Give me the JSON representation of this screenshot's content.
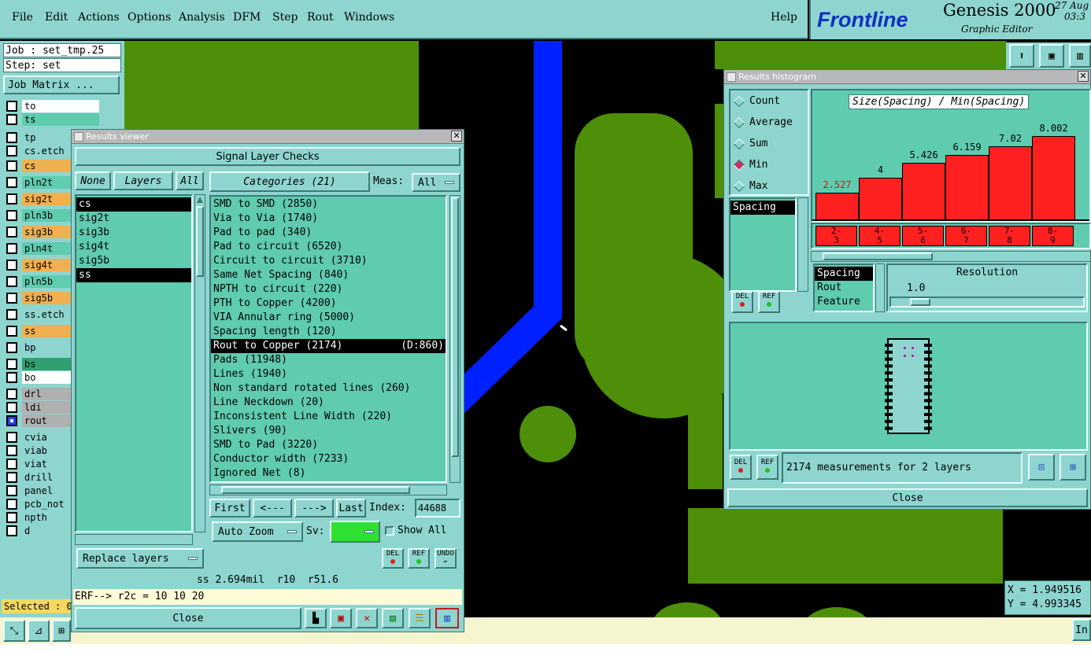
{
  "menu": {
    "items": [
      "File",
      "Edit",
      "Actions",
      "Options",
      "Analysis",
      "DFM",
      "Step",
      "Rout",
      "Windows"
    ],
    "help": "Help"
  },
  "brand": {
    "logo": "Frontline",
    "product": "Genesis 2000",
    "subtitle": "Graphic Editor",
    "date_line1": "27 Aug",
    "date_line2": "03:3"
  },
  "job": {
    "job_label": "Job : set_tmp.25",
    "step_label": "Step: set",
    "matrix_button": "Job Matrix ..."
  },
  "layers": [
    {
      "name": "to",
      "color": "#ffffff"
    },
    {
      "name": "ts",
      "color": "#5fcbaf"
    },
    {
      "name": "tp",
      "color": "#8ed5cf"
    },
    {
      "name": "cs.etch",
      "color": "#8ed5cf"
    },
    {
      "name": "cs",
      "color": "#f0b050"
    },
    {
      "name": "pln2t",
      "color": "#5fcbaf"
    },
    {
      "name": "sig2t",
      "color": "#f0b050"
    },
    {
      "name": "pln3b",
      "color": "#5fcbaf"
    },
    {
      "name": "sig3b",
      "color": "#f0b050"
    },
    {
      "name": "pln4t",
      "color": "#5fcbaf"
    },
    {
      "name": "sig4t",
      "color": "#f0b050"
    },
    {
      "name": "pln5b",
      "color": "#5fcbaf"
    },
    {
      "name": "sig5b",
      "color": "#f0b050"
    },
    {
      "name": "ss.etch",
      "color": "#8ed5cf"
    },
    {
      "name": "ss",
      "color": "#f0b050"
    },
    {
      "name": "bp",
      "color": "#8ed5cf"
    },
    {
      "name": "bs",
      "color": "#30a070"
    },
    {
      "name": "bo",
      "color": "#ffffff"
    },
    {
      "name": "drl",
      "color": "#b0b0b0"
    },
    {
      "name": "ldi",
      "color": "#b0b0b0"
    },
    {
      "name": "rout",
      "color": "#b0b0b0",
      "active": true
    },
    {
      "name": "cvia",
      "color": "#8ed5cf"
    },
    {
      "name": "viab",
      "color": "#8ed5cf"
    },
    {
      "name": "viat",
      "color": "#8ed5cf"
    },
    {
      "name": "drill",
      "color": "#8ed5cf"
    },
    {
      "name": "panel",
      "color": "#8ed5cf"
    },
    {
      "name": "pcb_not",
      "color": "#8ed5cf"
    },
    {
      "name": "npth",
      "color": "#8ed5cf"
    },
    {
      "name": "d",
      "color": "#8ed5cf"
    }
  ],
  "selected_label": "Selected : 0",
  "results_viewer": {
    "title": "Results viewer",
    "header": "Signal Layer Checks",
    "none_btn": "None",
    "layers_btn": "Layers",
    "all_btn": "All",
    "layer_list": [
      {
        "name": "cs",
        "selected": true
      },
      {
        "name": "sig2t",
        "selected": false
      },
      {
        "name": "sig3b",
        "selected": false
      },
      {
        "name": "sig4t",
        "selected": false
      },
      {
        "name": "sig5b",
        "selected": false
      },
      {
        "name": "ss",
        "selected": true
      }
    ],
    "categories_btn": "Categories (21)",
    "meas_label": "Meas:",
    "meas_value": "All",
    "categories": [
      {
        "text": "SMD to SMD (2850)"
      },
      {
        "text": "Via to Via (1740)"
      },
      {
        "text": "Pad to pad (340)"
      },
      {
        "text": "Pad to circuit (6520)"
      },
      {
        "text": "Circuit to circuit (3710)"
      },
      {
        "text": "Same Net Spacing (840)"
      },
      {
        "text": "NPTH to circuit (220)"
      },
      {
        "text": "PTH to Copper (4200)"
      },
      {
        "text": "VIA Annular ring (5000)"
      },
      {
        "text": "Spacing length (120)"
      },
      {
        "text": "Rout to Copper (2174)",
        "extra": "(D:860)",
        "selected": true
      },
      {
        "text": "Pads (11948)"
      },
      {
        "text": "Lines (1940)"
      },
      {
        "text": "Non standard rotated lines (260)"
      },
      {
        "text": "Line Neckdown (20)"
      },
      {
        "text": "Inconsistent Line Width (220)"
      },
      {
        "text": "Slivers (90)"
      },
      {
        "text": "SMD to Pad (3220)"
      },
      {
        "text": "Conductor width (7233)"
      },
      {
        "text": "Ignored Net (8)"
      }
    ],
    "nav": {
      "first": "First",
      "prev": "<---",
      "next": "--->",
      "last": "Last",
      "index_label": "Index:",
      "index_value": "44688"
    },
    "auto_zoom": "Auto Zoom",
    "sv_label": "Sv:",
    "show_all": "Show All",
    "replace_layers": "Replace layers",
    "del": "DEL",
    "ref": "REF",
    "undo": "UNDO",
    "status": "ss 2.694mil  r10  r51.6",
    "erf": "ERF--> r2c = 10 10 20",
    "close": "Close"
  },
  "histogram": {
    "title": "Results histogram",
    "options": [
      {
        "label": "Count",
        "on": false
      },
      {
        "label": "Average",
        "on": false
      },
      {
        "label": "Sum",
        "on": false
      },
      {
        "label": "Min",
        "on": true
      },
      {
        "label": "Max",
        "on": false
      }
    ],
    "chart_title": "Size(Spacing) / Min(Spacing)",
    "chart_data": {
      "type": "bar",
      "categories": [
        "2-3",
        "4-5",
        "5-6",
        "6-7",
        "7-8",
        "8-9"
      ],
      "values": [
        2.527,
        4,
        5.426,
        6.159,
        7.02,
        8.002
      ],
      "value_labels": [
        "2.527",
        "4",
        "5.426",
        "6.159",
        "7.02",
        "8.002"
      ],
      "category_labels": [
        [
          "2-",
          "3"
        ],
        [
          "4-",
          "5"
        ],
        [
          "5-",
          "6"
        ],
        [
          "6-",
          "7"
        ],
        [
          "7-",
          "8"
        ],
        [
          "8-",
          "9"
        ]
      ],
      "ylim": [
        0,
        8.9
      ]
    },
    "spacing_item": "Spacing",
    "type_list": [
      "Spacing",
      "Rout",
      "Feature"
    ],
    "resolution_label": "Resolution",
    "resolution_value": "1.0",
    "resolution_fraction": 0.1,
    "measurements": "2174 measurements for 2 layers",
    "del": "DEL",
    "ref": "REF",
    "close": "Close"
  },
  "coords": {
    "x": "X = 1.949516",
    "y": "Y = 4.993345"
  },
  "bottom_button": "In"
}
